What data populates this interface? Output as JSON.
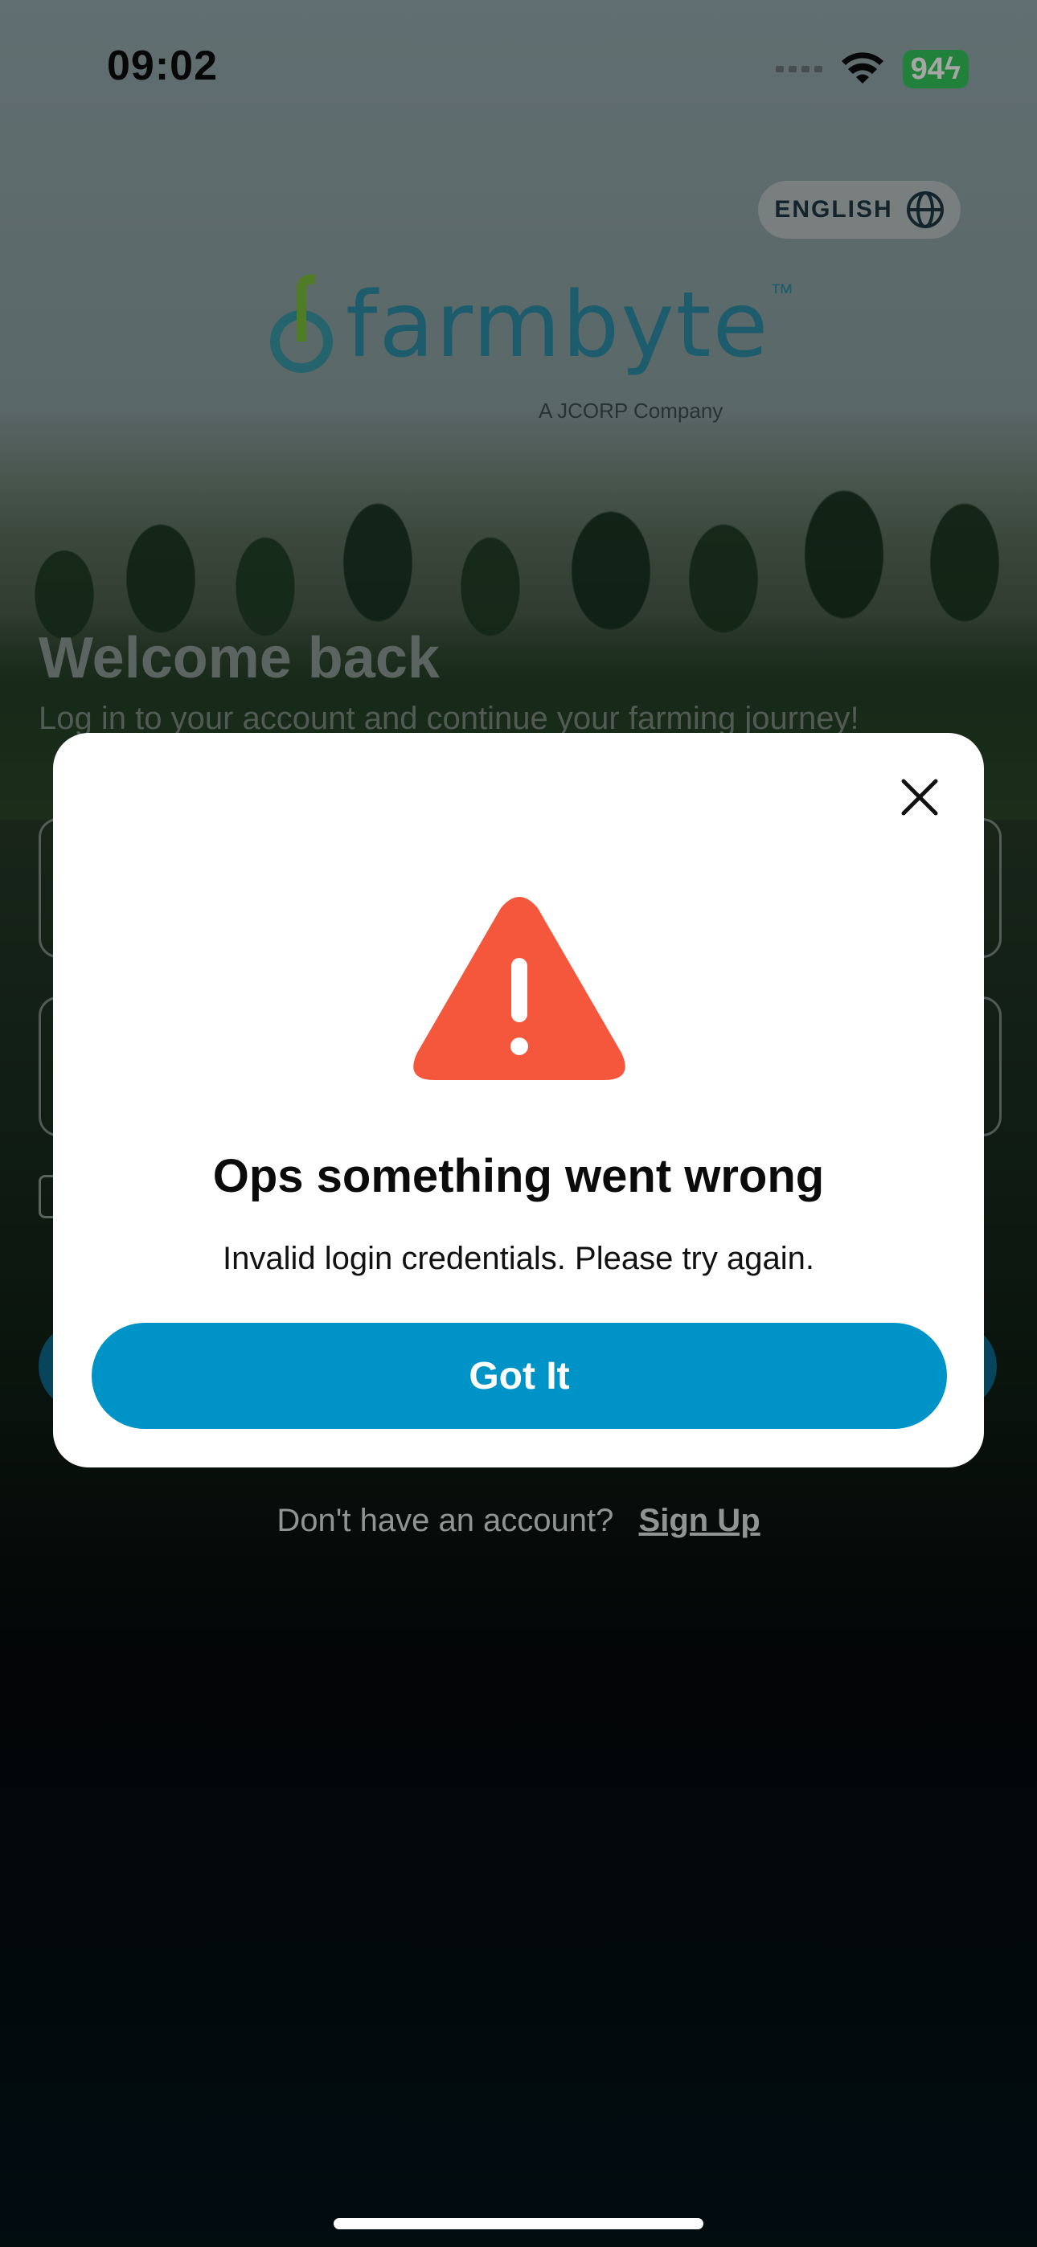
{
  "status": {
    "time": "09:02",
    "battery": "94"
  },
  "header": {
    "language_label": "ENGLISH"
  },
  "logo": {
    "wordmark": "farmbyte",
    "trademark": "™",
    "tagline": "A JCORP Company"
  },
  "login": {
    "title": "Welcome back",
    "subtitle": "Log in to your account and continue your farming journey!",
    "signup_prompt": "Don't have an account?",
    "signup_link": "Sign Up"
  },
  "dialog": {
    "title": "Ops something went wrong",
    "message": "Invalid login credentials. Please try again.",
    "button_label": "Got It"
  },
  "colors": {
    "accent": "#0093c8",
    "warning": "#f5573d",
    "logo": "#2c8ea7"
  }
}
